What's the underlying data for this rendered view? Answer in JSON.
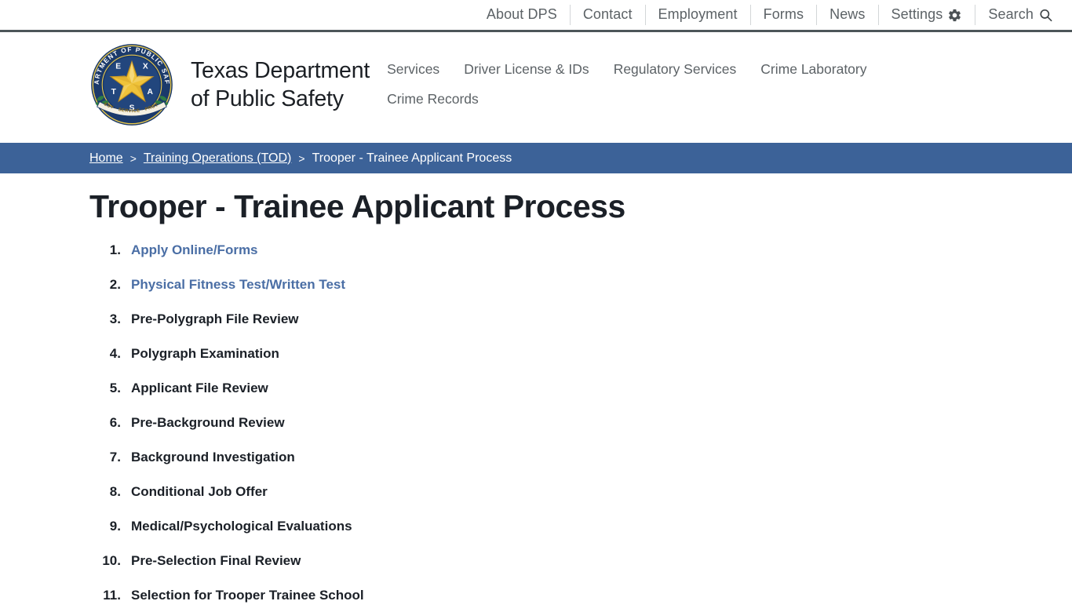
{
  "theme": {
    "breadcrumb_bg": "#3c6298",
    "link_blue": "#4a6ea5",
    "topbar_border": "#4d5659",
    "text_dark": "#1b2027",
    "nav_gray": "#5c6266",
    "seal_navy": "#1b3a6b",
    "seal_gold": "#efc33a"
  },
  "topbar": {
    "items": [
      {
        "label": "About DPS",
        "icon": null
      },
      {
        "label": "Contact",
        "icon": null
      },
      {
        "label": "Employment",
        "icon": null
      },
      {
        "label": "Forms",
        "icon": null
      },
      {
        "label": "News",
        "icon": null
      },
      {
        "label": "Settings",
        "icon": "gear-icon"
      },
      {
        "label": "Search",
        "icon": "search-icon"
      }
    ]
  },
  "header": {
    "logo": {
      "alt": "Texas Department of Public Safety seal",
      "ring_text": "DEPARTMENT OF PUBLIC SAFETY",
      "star_letters": [
        "E",
        "X",
        "A",
        "S",
        "T"
      ],
      "banner_text": "COURTESY · SERVICE · PROTECTION"
    },
    "brand_line1": "Texas Department",
    "brand_line2": "of Public Safety",
    "nav": [
      {
        "label": "Services"
      },
      {
        "label": "Driver License & IDs"
      },
      {
        "label": "Regulatory Services"
      },
      {
        "label": "Crime Laboratory"
      },
      {
        "label": "Crime Records"
      }
    ]
  },
  "breadcrumb": {
    "separator": ">",
    "items": [
      {
        "label": "Home",
        "is_link": true
      },
      {
        "label": "Training Operations (TOD)",
        "is_link": true
      },
      {
        "label": "Trooper - Trainee Applicant Process",
        "is_link": false
      }
    ]
  },
  "main": {
    "title": "Trooper - Trainee Applicant Process",
    "steps": [
      {
        "label": "Apply Online/Forms",
        "is_link": true
      },
      {
        "label": "Physical Fitness Test/Written Test",
        "is_link": true
      },
      {
        "label": "Pre-Polygraph File Review",
        "is_link": false
      },
      {
        "label": "Polygraph Examination",
        "is_link": false
      },
      {
        "label": "Applicant File Review",
        "is_link": false
      },
      {
        "label": "Pre-Background Review",
        "is_link": false
      },
      {
        "label": "Background Investigation",
        "is_link": false
      },
      {
        "label": "Conditional Job Offer",
        "is_link": false
      },
      {
        "label": "Medical/Psychological Evaluations",
        "is_link": false
      },
      {
        "label": "Pre-Selection Final Review",
        "is_link": false
      },
      {
        "label": "Selection for Trooper Trainee School",
        "is_link": false
      }
    ]
  }
}
